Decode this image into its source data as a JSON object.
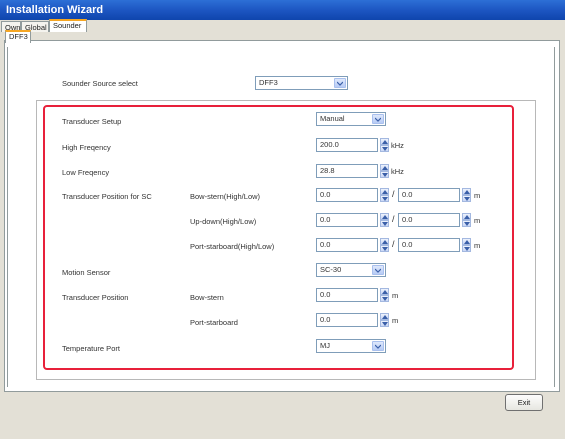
{
  "window": {
    "title": "Installation Wizard"
  },
  "tabs": [
    {
      "label": "Own"
    },
    {
      "label": "Global"
    },
    {
      "label": "Sounder"
    }
  ],
  "subtabs": [
    {
      "label": "DFF3"
    }
  ],
  "sounder_source": {
    "label": "Sounder Source select",
    "value": "DFF3"
  },
  "transducer_setup": {
    "label": "Transducer Setup",
    "value": "Manual"
  },
  "high_frequency": {
    "label": "High Freqency",
    "value": "200.0",
    "unit": "kHz"
  },
  "low_frequency": {
    "label": "Low Freqency",
    "value": "28.8",
    "unit": "kHz"
  },
  "transducer_position_sc": {
    "label": "Transducer Position for SC",
    "rows": [
      {
        "label": "Bow-stern(High/Low)",
        "high": "0.0",
        "low": "0.0",
        "sep": "/",
        "unit": "m"
      },
      {
        "label": "Up-down(High/Low)",
        "high": "0.0",
        "low": "0.0",
        "sep": "/",
        "unit": "m"
      },
      {
        "label": "Port-starboard(High/Low)",
        "high": "0.0",
        "low": "0.0",
        "sep": "/",
        "unit": "m"
      }
    ]
  },
  "motion_sensor": {
    "label": "Motion Sensor",
    "value": "SC-30"
  },
  "transducer_position": {
    "label": "Transducer Position",
    "rows": [
      {
        "label": "Bow-stern",
        "value": "0.0",
        "unit": "m"
      },
      {
        "label": "Port-starboard",
        "value": "0.0",
        "unit": "m"
      }
    ]
  },
  "temperature_port": {
    "label": "Temperature Port",
    "value": "MJ"
  },
  "footer": {
    "exit_label": "Exit"
  },
  "colors": {
    "title_bar": "#1d56c2",
    "highlight_box": "#e8203a",
    "active_tab": "#f5a623"
  }
}
